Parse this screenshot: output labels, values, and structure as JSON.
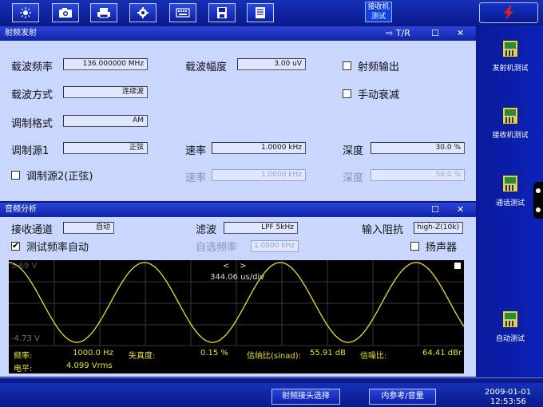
{
  "toolbar": {
    "buttons": [
      "brightness-icon",
      "camera-icon",
      "printer-icon",
      "gear-icon",
      "keyboard-icon",
      "save-icon",
      "document-icon"
    ],
    "rx_badge": "接收机\n测试"
  },
  "rf_panel": {
    "title": "射频发射",
    "tr_label": "T/R",
    "carrier_freq_label": "载波频率",
    "carrier_freq_value": "136.000000 MHz",
    "carrier_amp_label": "载波幅度",
    "carrier_amp_value": "3.00 uV",
    "rf_output_label": "射频输出",
    "mod_mode_label": "载波方式",
    "mod_mode_value": "连续波",
    "manual_atten_label": "手动衰减",
    "mod_format_label": "调制格式",
    "mod_format_value": "AM",
    "mod_src1_label": "调制源1",
    "mod_src1_value": "正弦",
    "rate1_label": "速率",
    "rate1_value": "1.0000 kHz",
    "depth1_label": "深度",
    "depth1_value": "30.0 %",
    "mod_src2_label": "调制源2(正弦)",
    "rate2_label": "速率",
    "rate2_value": "1.0000 kHz",
    "depth2_label": "深度",
    "depth2_value": "50.0 %"
  },
  "af_panel": {
    "title": "音频分析",
    "rx_channel_label": "接收通道",
    "rx_channel_value": "自动",
    "filter_label": "滤波",
    "filter_value": "LPF 5kHz",
    "impedance_label": "输入阻抗",
    "impedance_value": "high-Z(10k)",
    "auto_freq_label": "测试频率自动",
    "manual_freq_label": "自选频率",
    "manual_freq_value": "1.0000 kHz",
    "speaker_label": "扬声器"
  },
  "scope": {
    "y_max": "5.69 V",
    "y_min": "-4.73 V",
    "nav": "<    >",
    "timebase": "344.06 us/div",
    "readouts": {
      "freq_label": "频率:",
      "freq_value": "1000.0 Hz",
      "distortion_label": "失真度:",
      "distortion_value": "0.15 %",
      "sinad_label": "信纳比(sinad):",
      "sinad_value": "55.91 dB",
      "snr_label": "信噪比:",
      "snr_value": "64.41 dBr",
      "level_label": "电平:",
      "level_value": "4.099 Vrms"
    }
  },
  "side": {
    "items": [
      "发射机测试",
      "接收机测试",
      "通话测试",
      "自动测试"
    ]
  },
  "bottom": {
    "rf_connector": "射频接头选择",
    "ref_volume": "内参考/音量",
    "date": "2009-01-01",
    "time": "12:53:56"
  }
}
